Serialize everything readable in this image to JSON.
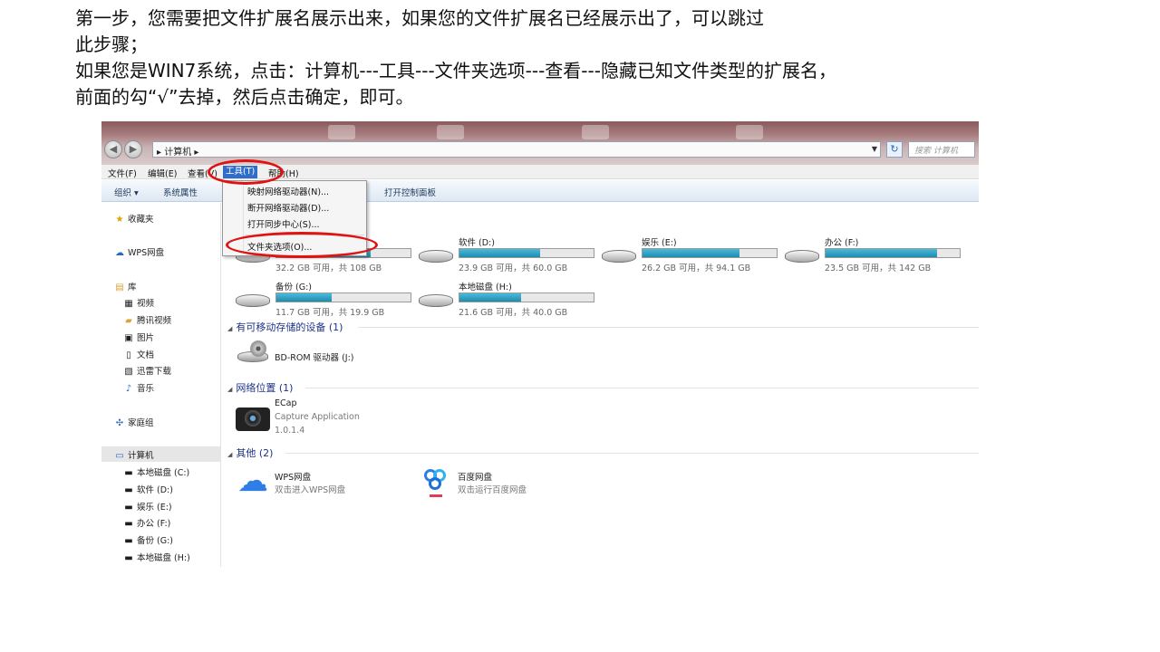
{
  "instructions": {
    "line1": "第一步，您需要把文件扩展名展示出来，如果您的文件扩展名已经展示出了，可以跳过",
    "line2": "此步骤；",
    "line3": "如果您是WIN7系统，点击：计算机---工具---文件夹选项---查看---隐藏已知文件类型的扩展名，",
    "line4": "前面的勾“√”去掉，然后点击确定，即可。"
  },
  "explorer": {
    "breadcrumb": "▸ 计算机 ▸",
    "search_placeholder": "搜索 计算机",
    "menu": {
      "file": "文件(F)",
      "edit": "编辑(E)",
      "view": "查看(V)",
      "tools": "工具(T)",
      "help": "帮助(H)"
    },
    "toolbar": {
      "organize": "组织 ▾",
      "system_properties": "系统属性",
      "open_control_panel": "打开控制面板"
    },
    "tools_menu": {
      "items": [
        "映射网络驱动器(N)...",
        "断开网络驱动器(D)...",
        "打开同步中心(S)...",
        "文件夹选项(O)..."
      ]
    },
    "sidebar": {
      "favorites": "收藏夹",
      "wps_cloud": "WPS网盘",
      "libraries": "库",
      "lib_items": [
        "视频",
        "腾讯视频",
        "图片",
        "文档",
        "迅雷下载",
        "音乐"
      ],
      "homegroup": "家庭组",
      "computer": "计算机",
      "drives": [
        "本地磁盘 (C:)",
        "软件 (D:)",
        "娱乐 (E:)",
        "办公 (F:)",
        "备份 (G:)",
        "本地磁盘 (H:)"
      ]
    },
    "drives": [
      {
        "name": "",
        "free": "32.2 GB 可用，共 108 GB",
        "used_fraction": 0.7
      },
      {
        "name": "软件 (D:)",
        "free": "23.9 GB 可用，共 60.0 GB",
        "used_fraction": 0.6
      },
      {
        "name": "娱乐 (E:)",
        "free": "26.2 GB 可用，共 94.1 GB",
        "used_fraction": 0.72
      },
      {
        "name": "办公 (F:)",
        "free": "23.5 GB 可用，共 142 GB",
        "used_fraction": 0.83
      },
      {
        "name": "备份 (G:)",
        "free": "11.7 GB 可用，共 19.9 GB",
        "used_fraction": 0.41
      },
      {
        "name": "本地磁盘 (H:)",
        "free": "21.6 GB 可用，共 40.0 GB",
        "used_fraction": 0.46
      }
    ],
    "groups": {
      "removable": "有可移动存储的设备 (1)",
      "network": "网络位置 (1)",
      "other": "其他 (2)"
    },
    "bdrom": "BD-ROM 驱动器 (J:)",
    "ecap": {
      "name": "ECap",
      "desc": "Capture Application",
      "version": "1.0.1.4"
    },
    "wps": {
      "name": "WPS网盘",
      "desc": "双击进入WPS网盘"
    },
    "baidu": {
      "name": "百度网盘",
      "desc": "双击运行百度网盘"
    },
    "colors": {
      "highlight_ring": "#e01212",
      "menu_active": "#2f6dc9",
      "drive_fill": "#1d8db1"
    }
  }
}
